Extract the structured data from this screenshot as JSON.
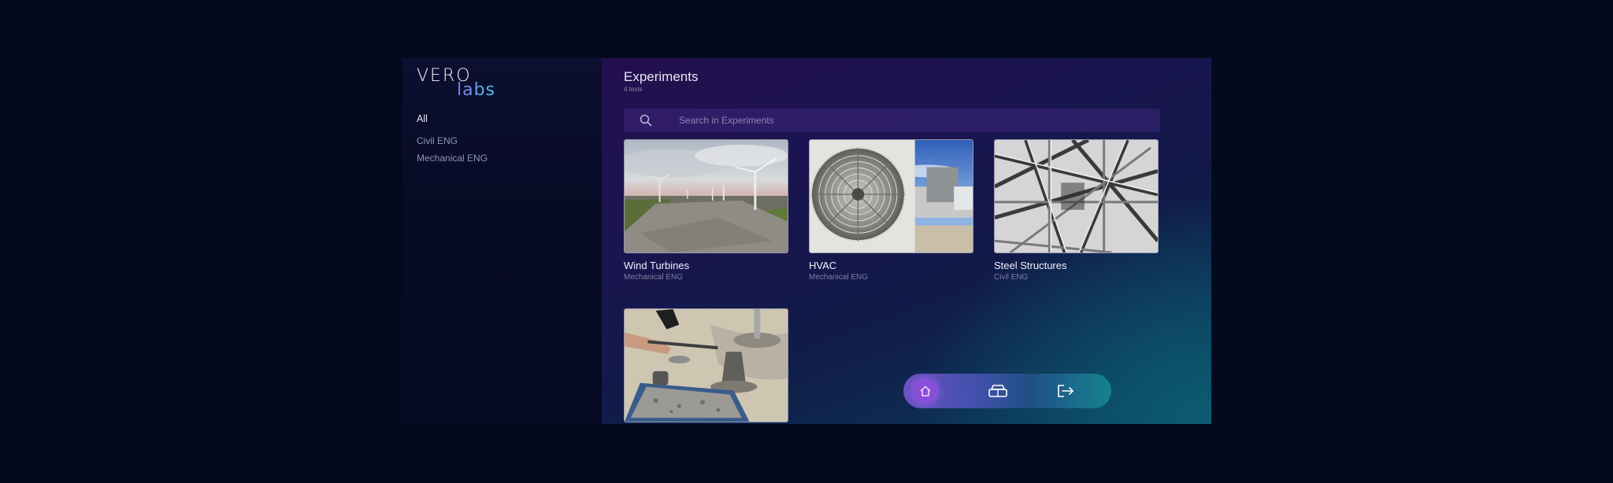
{
  "app": {
    "logo_line1": "VERO",
    "logo_line2": "labs"
  },
  "sidebar": {
    "categories": [
      {
        "label": "All",
        "active": true
      },
      {
        "label": "Civil ENG",
        "active": false
      },
      {
        "label": "Mechanical ENG",
        "active": false
      }
    ]
  },
  "main": {
    "title": "Experiments",
    "count": "4 tests",
    "search": {
      "placeholder": "Search in Experiments",
      "value": ""
    },
    "cards": [
      {
        "title": "Wind Turbines",
        "category": "Mechanical ENG"
      },
      {
        "title": "HVAC",
        "category": "Mechanical ENG"
      },
      {
        "title": "Steel Structures",
        "category": "Civil ENG"
      },
      {
        "title": "",
        "category": ""
      }
    ]
  },
  "dock": {
    "items": [
      {
        "icon": "home-icon",
        "active": true
      },
      {
        "icon": "vr-headset-icon",
        "active": false
      },
      {
        "icon": "logout-icon",
        "active": false
      }
    ]
  },
  "colors": {
    "page_bg": "#030a1e",
    "sidebar_bg": "#0a0e2c",
    "accent_purple": "#8a4fd8",
    "accent_teal": "#16828f"
  }
}
